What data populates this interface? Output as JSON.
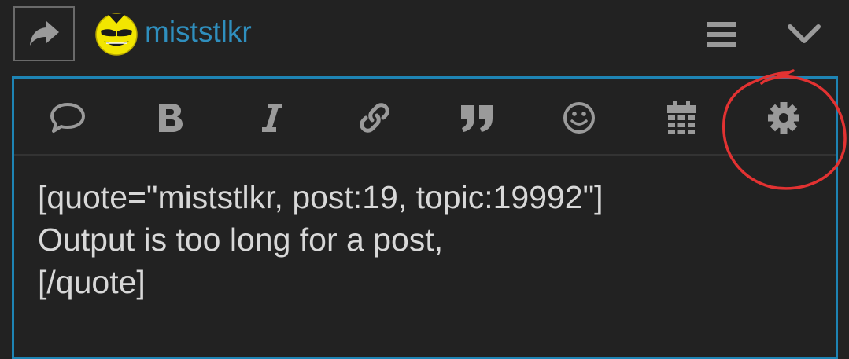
{
  "header": {
    "username": "miststlkr",
    "icons": [
      "reply-arrow-icon",
      "avatar-smiley",
      "hamburger-menu-icon",
      "chevron-down-icon"
    ]
  },
  "toolbar": {
    "buttons": [
      {
        "name": "speech-bubble-icon"
      },
      {
        "name": "bold-icon"
      },
      {
        "name": "italic-icon"
      },
      {
        "name": "link-icon"
      },
      {
        "name": "quote-icon"
      },
      {
        "name": "emoji-icon"
      },
      {
        "name": "calendar-icon"
      },
      {
        "name": "gear-icon"
      }
    ]
  },
  "editor": {
    "lines": [
      "[quote=\"miststlkr, post:19, topic:19992\"]",
      "Output is too long for a post,",
      "[/quote]"
    ]
  },
  "colors": {
    "background": "#222222",
    "accent": "#1e84b4",
    "username": "#2f8fbe",
    "icon": "#9a9a9a",
    "annotation": "#e23232"
  }
}
